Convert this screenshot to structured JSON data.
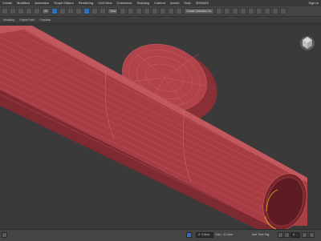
{
  "menu": {
    "items": [
      "Create",
      "Modifiers",
      "Animation",
      "Graph Editors",
      "Rendering",
      "Civil View",
      "Customize",
      "Scripting",
      "Content",
      "Arnold",
      "Help",
      "3DSMAX"
    ],
    "sign_in": "Sign In"
  },
  "toolbar": {
    "view_dropdown": "View",
    "selection_set_dropdown": "Create Selection Se"
  },
  "ribbon": {
    "items": [
      "Modeling",
      "Object Paint",
      "Populate"
    ]
  },
  "status": {
    "coord_readout": "X: 3.5cm",
    "grid_readout": "Grid = 10.0cm",
    "add_time_tag": "Add Time Tag",
    "frame_field": "0"
  },
  "colors": {
    "mesh_fill": "#b0444a",
    "mesh_dark": "#8a2f35",
    "wire": "#d26a70",
    "viewport_bg": "#3a3a3a",
    "accent_blue": "#2f6fbf",
    "selection_orange": "#e8a020"
  }
}
